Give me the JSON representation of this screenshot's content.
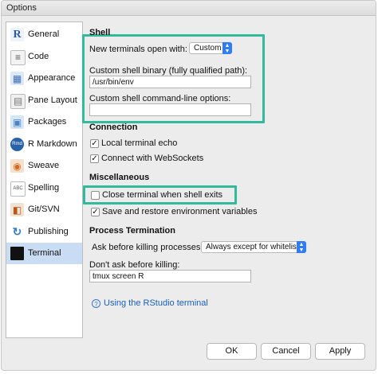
{
  "window": {
    "title": "Options"
  },
  "sidebar": {
    "items": [
      {
        "label": "General",
        "icon": "r-logo-icon",
        "glyph": "R",
        "active": false
      },
      {
        "label": "Code",
        "icon": "code-page-icon",
        "glyph": "≡",
        "active": false
      },
      {
        "label": "Appearance",
        "icon": "appearance-palette-icon",
        "glyph": "▦",
        "active": false
      },
      {
        "label": "Pane Layout",
        "icon": "pane-layout-icon",
        "glyph": "▤",
        "active": false
      },
      {
        "label": "Packages",
        "icon": "packages-box-icon",
        "glyph": "▣",
        "active": false
      },
      {
        "label": "R Markdown",
        "icon": "rmarkdown-icon",
        "glyph": "Rmd",
        "active": false
      },
      {
        "label": "Sweave",
        "icon": "sweave-icon",
        "glyph": "◉",
        "active": false
      },
      {
        "label": "Spelling",
        "icon": "spelling-abc-icon",
        "glyph": "ABC",
        "active": false
      },
      {
        "label": "Git/SVN",
        "icon": "git-svn-icon",
        "glyph": "◧",
        "active": false
      },
      {
        "label": "Publishing",
        "icon": "publishing-icon",
        "glyph": "↻",
        "active": false
      },
      {
        "label": "Terminal",
        "icon": "terminal-icon",
        "glyph": "",
        "active": true
      }
    ]
  },
  "shell": {
    "section_title": "Shell",
    "open_with_label": "New terminals open with:",
    "open_with_value": "Custom",
    "binary_label": "Custom shell binary (fully qualified path):",
    "binary_value": "/usr/bin/env",
    "options_label": "Custom shell command-line options:",
    "options_value": ""
  },
  "connection": {
    "section_title": "Connection",
    "local_echo_label": "Local terminal echo",
    "local_echo_checked": true,
    "websockets_label": "Connect with WebSockets",
    "websockets_checked": true
  },
  "misc": {
    "section_title": "Miscellaneous",
    "close_on_exit_label": "Close terminal when shell exits",
    "close_on_exit_checked": false,
    "save_restore_label": "Save and restore environment variables",
    "save_restore_checked": true
  },
  "process": {
    "section_title": "Process Termination",
    "ask_label": "Ask before killing processes:",
    "ask_value": "Always except for whitelist",
    "dont_ask_label": "Don't ask before killing:",
    "dont_ask_value": "tmux screen R"
  },
  "help": {
    "link_text": "Using the RStudio terminal",
    "icon": "help-circle-icon"
  },
  "buttons": {
    "ok": "OK",
    "cancel": "Cancel",
    "apply": "Apply"
  },
  "colors": {
    "highlight": "#33b99c",
    "selection": "#c8dcf3",
    "select_accent": "#2f7cf6",
    "link": "#1b5fb5"
  }
}
